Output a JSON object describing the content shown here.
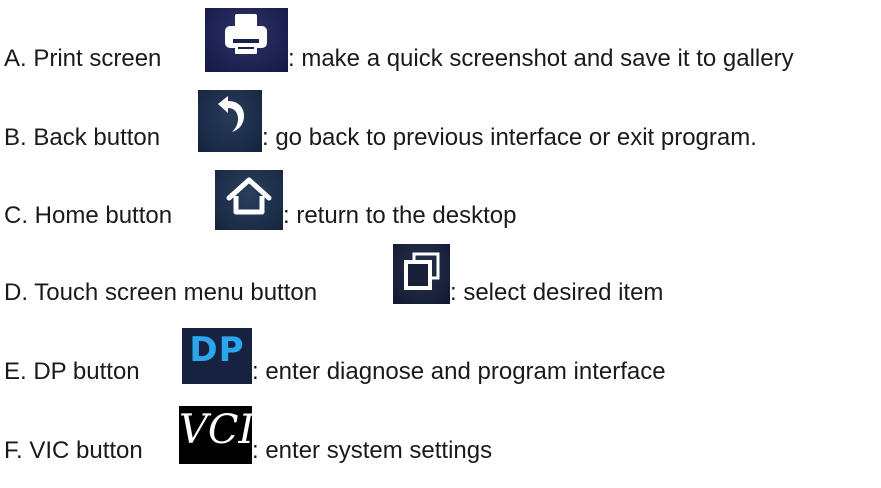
{
  "items": [
    {
      "id": "A",
      "prefix": "A. Print screen",
      "icon": "printer-icon",
      "description": ": make a quick screenshot and save it to gallery"
    },
    {
      "id": "B",
      "prefix": "B. Back button",
      "icon": "back-arrow-icon",
      "description": ": go back to previous interface or exit program."
    },
    {
      "id": "C",
      "prefix": "C. Home button",
      "icon": "home-icon",
      "description": ": return to the desktop"
    },
    {
      "id": "D",
      "prefix": "D. Touch screen menu button",
      "icon": "recent-apps-icon",
      "description": ": select desired item"
    },
    {
      "id": "E",
      "prefix": "E. DP button",
      "icon": "dp-icon",
      "icon_text": "DP",
      "description": ": enter diagnose and program interface"
    },
    {
      "id": "F",
      "prefix": "F. VIC button",
      "icon": "vci-icon",
      "icon_text": "VCI",
      "description": ": enter system settings"
    }
  ],
  "colors": {
    "text": "#1a1a1a",
    "icon_bg": "#1c2050",
    "icon_glyph": "#ffffff",
    "dp_text": "#2aa6ec"
  }
}
